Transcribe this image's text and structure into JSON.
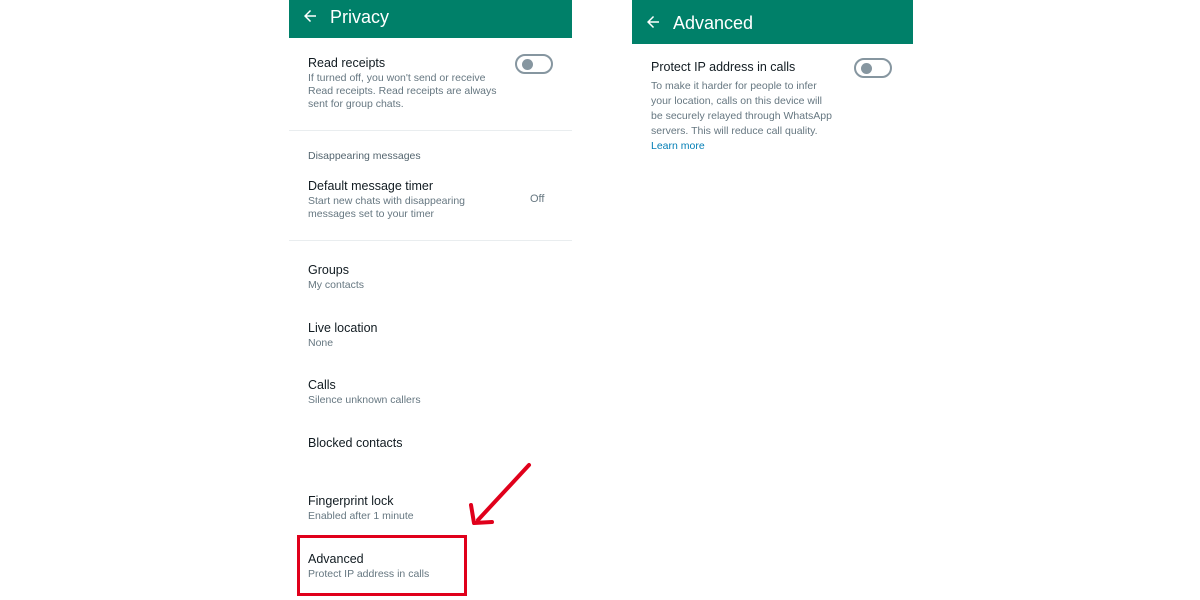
{
  "privacy": {
    "title": "Privacy",
    "read_receipts": {
      "title": "Read receipts",
      "subtitle": "If turned off, you won't send or receive Read receipts. Read receipts are always sent for group chats.",
      "enabled": false
    },
    "disappearing_header": "Disappearing messages",
    "default_timer": {
      "title": "Default message timer",
      "subtitle": "Start new chats with disappearing messages set to your timer",
      "value": "Off"
    },
    "items": [
      {
        "title": "Groups",
        "subtitle": "My contacts"
      },
      {
        "title": "Live location",
        "subtitle": "None"
      },
      {
        "title": "Calls",
        "subtitle": "Silence unknown callers"
      },
      {
        "title": "Blocked contacts",
        "subtitle": ""
      },
      {
        "title": "Fingerprint lock",
        "subtitle": "Enabled after 1 minute"
      },
      {
        "title": "Advanced",
        "subtitle": "Protect IP address in calls"
      }
    ]
  },
  "advanced": {
    "title": "Advanced",
    "protect_ip": {
      "title": "Protect IP address in calls",
      "description": "To make it harder for people to infer your location, calls on this device will be securely relayed through WhatsApp servers. This will reduce call quality.",
      "learn_more": "Learn more",
      "enabled": false
    }
  },
  "colors": {
    "app_bar": "#008069",
    "highlight": "#e0001b",
    "link": "#027eb5"
  },
  "icons": [
    "arrow-back-icon",
    "toggle-switch",
    "pointer-arrow"
  ]
}
